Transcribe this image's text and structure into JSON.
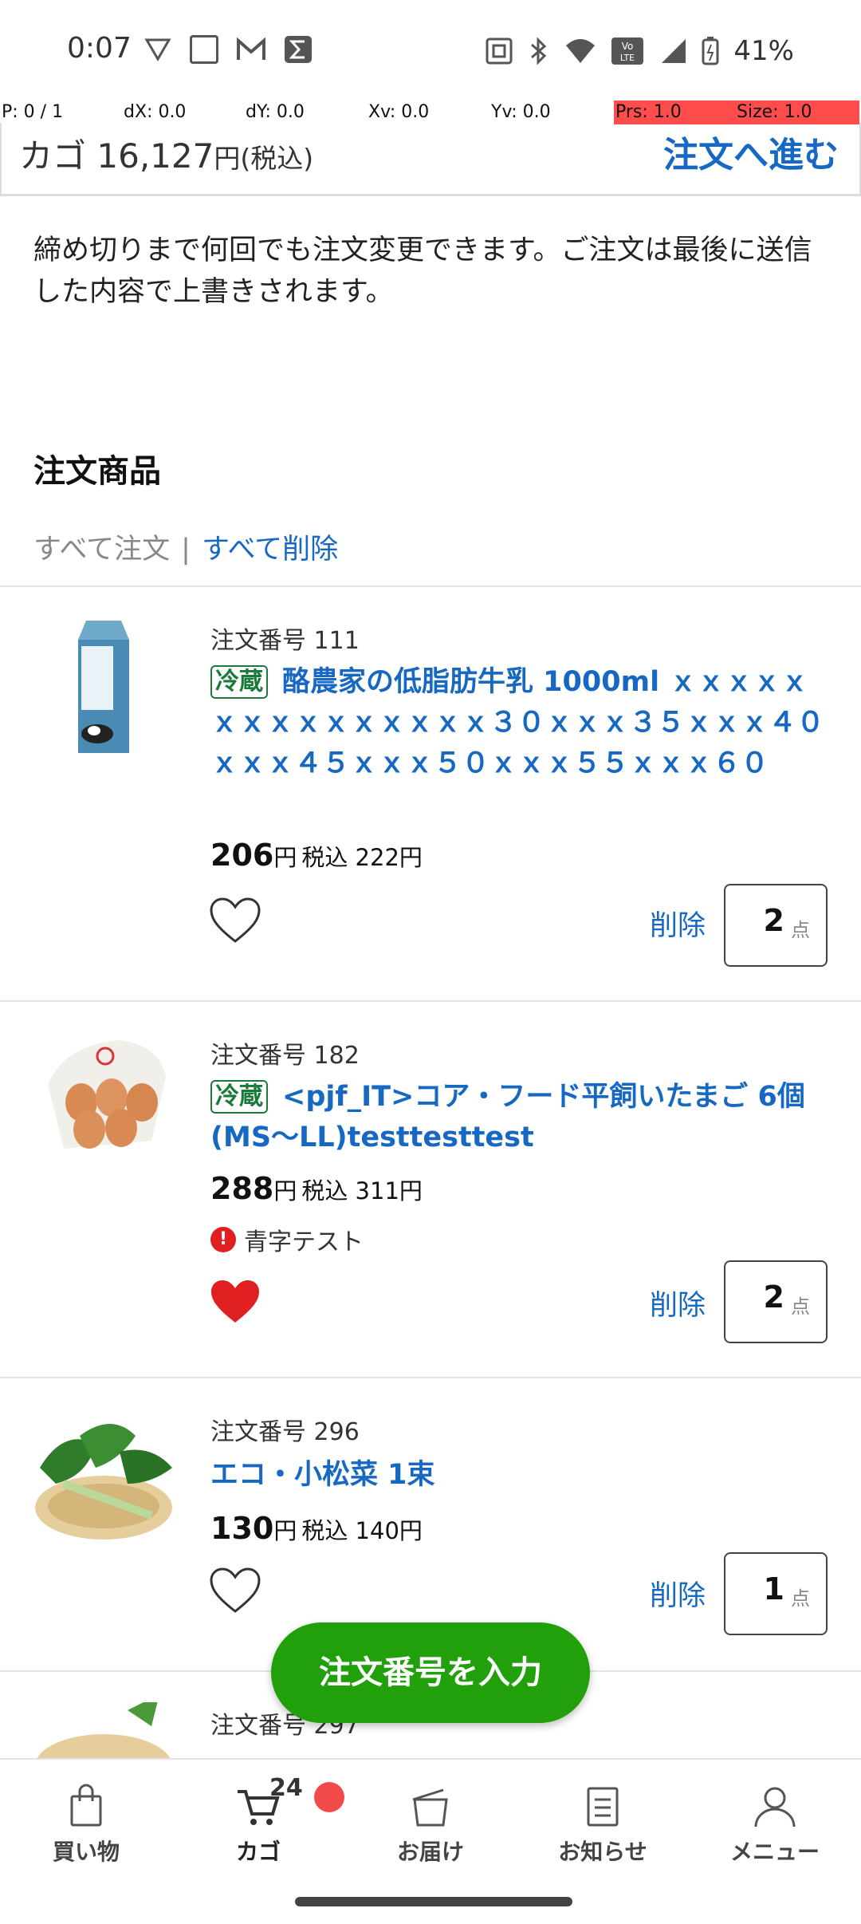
{
  "status_bar": {
    "time": "0:07",
    "battery": "41%"
  },
  "debug": {
    "p": "P: 0 / 1",
    "dx": "dX: 0.0",
    "dy": "dY: 0.0",
    "xv": "Xv: 0.0",
    "yv": "Yv: 0.0",
    "prs": "Prs: 1.0",
    "size": "Size: 1.0"
  },
  "cart": {
    "label": "カゴ",
    "amount": "16,127",
    "currency": "円(税込)",
    "proceed_label": "注文へ進む"
  },
  "notice": "締め切りまで何回でも注文変更できます。ご注文は最後に送信した内容で上書きされます。",
  "section": {
    "title": "注文商品",
    "order_all": "すべて注文",
    "separator": "|",
    "delete_all": "すべて削除"
  },
  "items": [
    {
      "order_no": "注文番号 111",
      "badge": "冷蔵",
      "name": "酪農家の低脂肪牛乳 1000ml ｘｘｘｘｘｘｘｘｘｘｘｘｘｘｘ３０ｘｘｘ３５ｘｘｘ４０ｘｘｘ４５ｘｘｘ５０ｘｘｘ５５ｘｘｘ６０",
      "price": "206",
      "price_unit": "円",
      "tax_price": "税込 222円",
      "favorite": false,
      "delete_label": "削除",
      "quantity": "2",
      "quantity_unit": "点"
    },
    {
      "order_no": "注文番号 182",
      "badge": "冷蔵",
      "name": "<pjf_IT>コア・フード平飼いたまご 6個(MS〜LL)testtesttest",
      "price": "288",
      "price_unit": "円",
      "tax_price": "税込 311円",
      "note": "青字テスト",
      "favorite": true,
      "delete_label": "削除",
      "quantity": "2",
      "quantity_unit": "点"
    },
    {
      "order_no": "注文番号 296",
      "name": "エコ・小松菜 1束",
      "price": "130",
      "price_unit": "円",
      "tax_price": "税込 140円",
      "favorite": false,
      "delete_label": "削除",
      "quantity": "1",
      "quantity_unit": "点"
    },
    {
      "order_no": "注文番号 297"
    }
  ],
  "fab_label": "注文番号を入力",
  "nav": {
    "shop": "買い物",
    "cart": "カゴ",
    "cart_count": "24",
    "delivery": "お届け",
    "news": "お知らせ",
    "menu": "メニュー"
  },
  "colors": {
    "link_blue": "#1668c2",
    "fab_green": "#21a00b",
    "chill_badge": "#1a7a3c",
    "favorite_red": "#e02020"
  }
}
